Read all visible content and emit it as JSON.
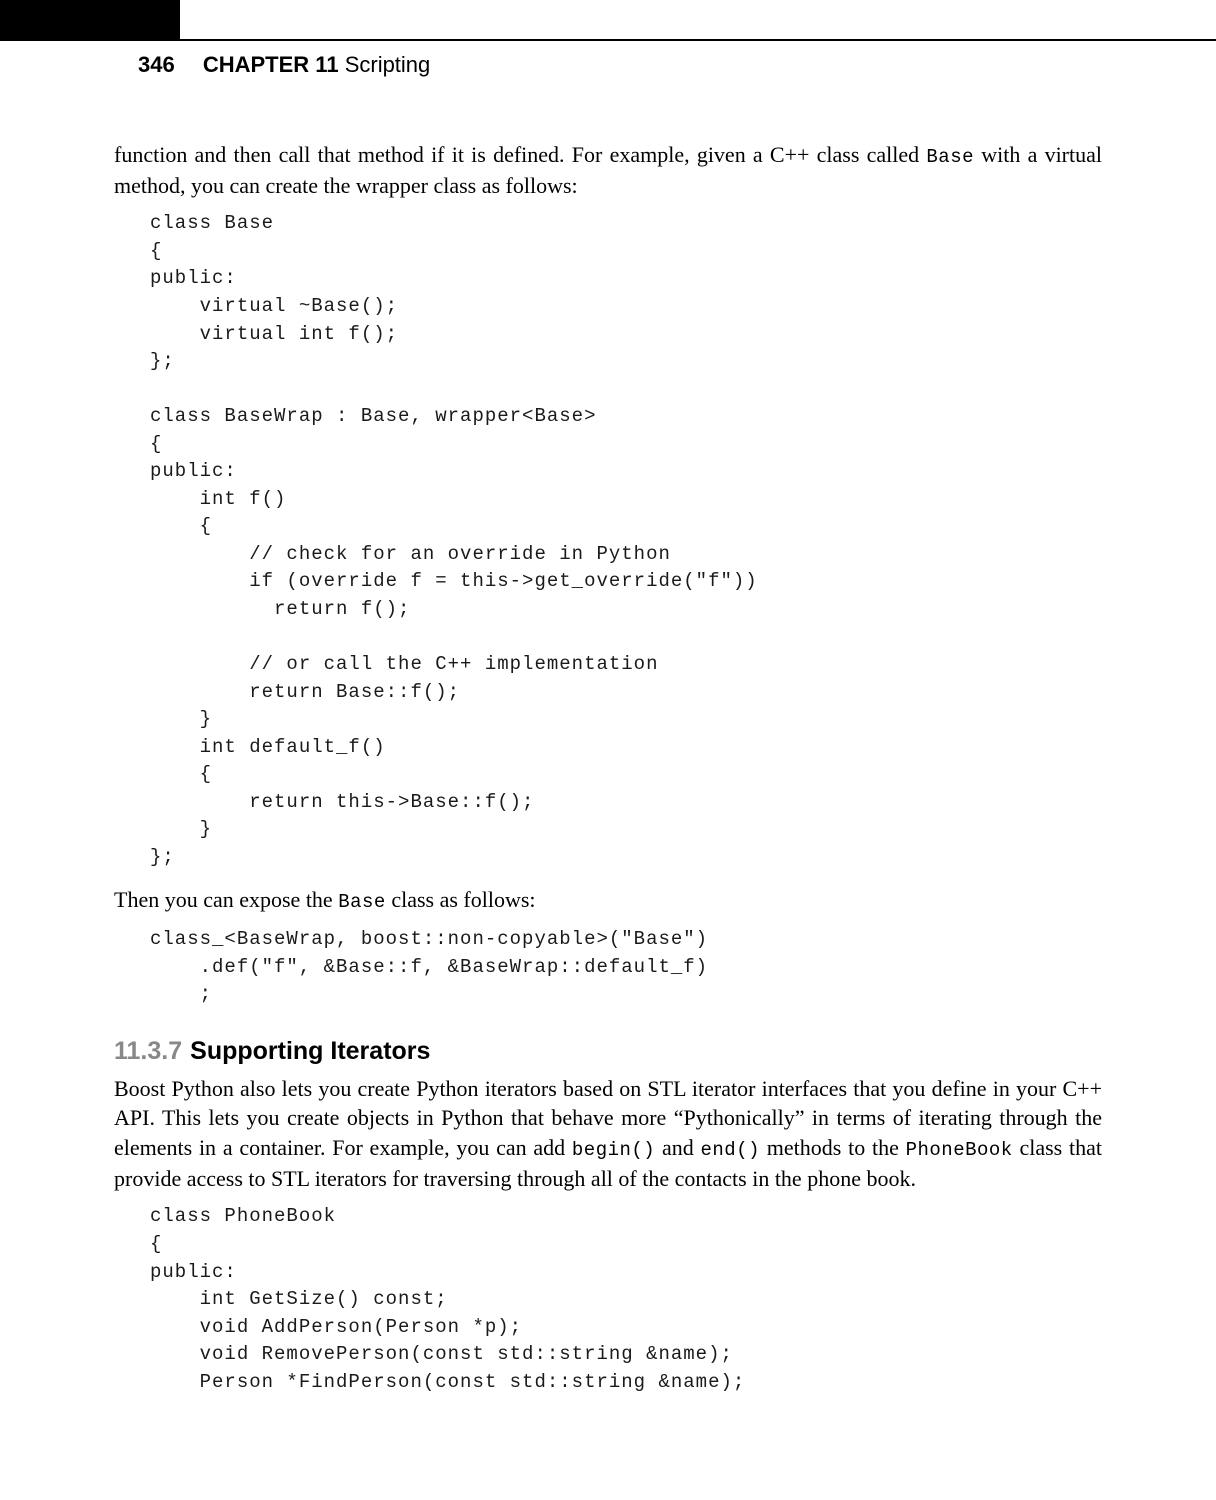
{
  "header": {
    "page_number": "346",
    "chapter_label": "CHAPTER 11",
    "chapter_title": "Scripting"
  },
  "para1_a": "function and then call that method if it is defined. For example, given a C++ class called ",
  "para1_code": "Base",
  "para1_b": " with a virtual method, you can create the wrapper class as follows:",
  "code1": "class Base\n{\npublic:\n    virtual ~Base();\n    virtual int f();\n};\n\nclass BaseWrap : Base, wrapper<Base>\n{\npublic:\n    int f()\n    {\n        // check for an override in Python\n        if (override f = this->get_override(\"f\"))\n          return f();\n\n        // or call the C++ implementation\n        return Base::f();\n    }\n    int default_f()\n    {\n        return this->Base::f();\n    }\n};",
  "para2_a": "Then you can expose the ",
  "para2_code": "Base",
  "para2_b": " class as follows:",
  "code2": "class_<BaseWrap, boost::non-copyable>(\"Base\")\n    .def(\"f\", &Base::f, &BaseWrap::default_f)\n    ;",
  "section": {
    "number": "11.3.7",
    "title": "Supporting Iterators"
  },
  "para3_a": "Boost Python also lets you create Python iterators based on STL iterator interfaces that you define in your C++ API. This lets you create objects in Python that behave more “Pythonically” in terms of iterating through the elements in a container. For example, you can add ",
  "para3_code1": "begin()",
  "para3_mid1": " and ",
  "para3_code2": "end()",
  "para3_b": " methods to the ",
  "para3_code3": "PhoneBook",
  "para3_c": " class that provide access to STL iterators for traversing through all of the contacts in the phone book.",
  "code3": "class PhoneBook\n{\npublic:\n    int GetSize() const;\n    void AddPerson(Person *p);\n    void RemovePerson(const std::string &name);\n    Person *FindPerson(const std::string &name);"
}
